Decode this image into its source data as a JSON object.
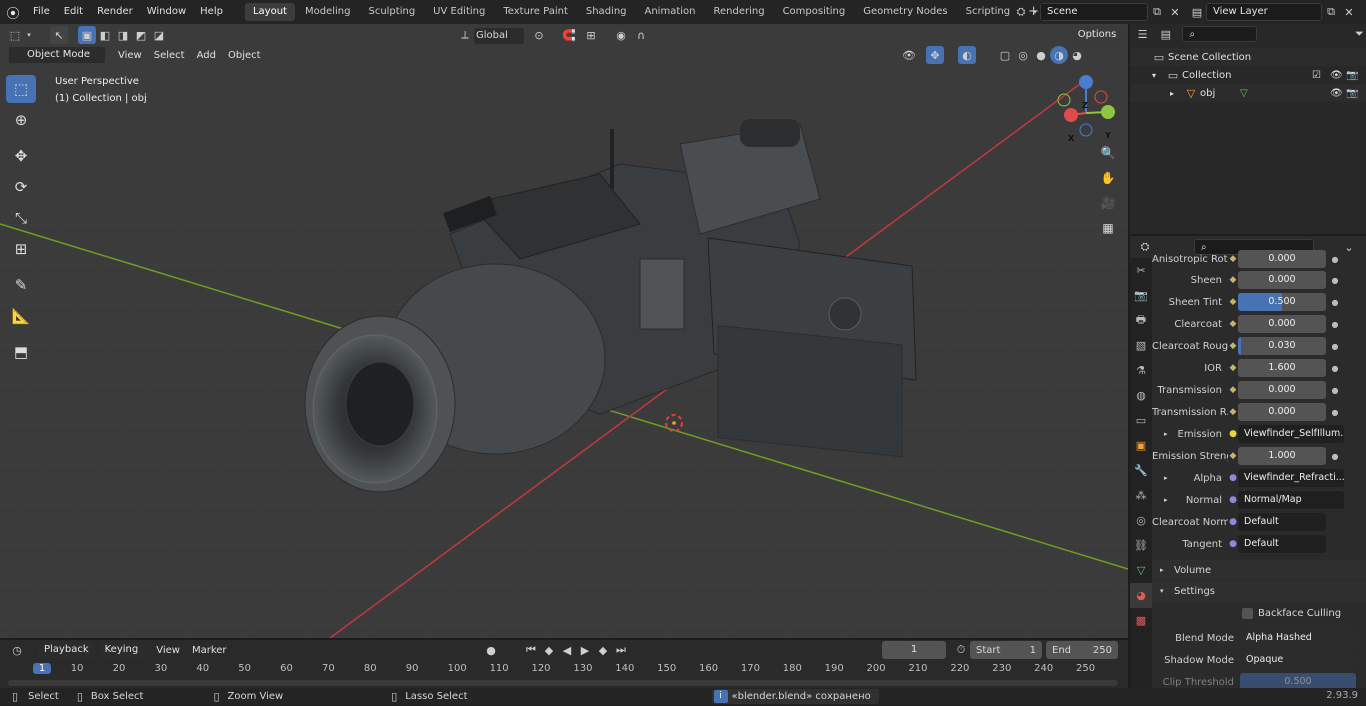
{
  "topbar": {
    "menus": [
      "File",
      "Edit",
      "Render",
      "Window",
      "Help"
    ],
    "workspaces": [
      "Layout",
      "Modeling",
      "Sculpting",
      "UV Editing",
      "Texture Paint",
      "Shading",
      "Animation",
      "Rendering",
      "Compositing",
      "Geometry Nodes",
      "Scripting"
    ],
    "active_workspace": "Layout",
    "add_tab": "+",
    "scene": "Scene",
    "view_layer": "View Layer"
  },
  "viewport": {
    "mode": "Object Mode",
    "menus": [
      "View",
      "Select",
      "Add",
      "Object"
    ],
    "transform_orientation": "Global",
    "options_label": "Options",
    "overlay_title": "User Perspective",
    "overlay_subtitle": "(1) Collection | obj",
    "gizmo": {
      "x": "X",
      "y": "Y",
      "z": "Z"
    }
  },
  "outliner": {
    "search_placeholder": "",
    "items": [
      {
        "label": "Scene Collection"
      },
      {
        "label": "Collection"
      },
      {
        "label": "obj"
      }
    ]
  },
  "properties": {
    "search_placeholder": "",
    "rows": [
      {
        "label": "Anisotropic Rot...",
        "value": "0.000"
      },
      {
        "label": "Sheen",
        "value": "0.000"
      },
      {
        "label": "Sheen Tint",
        "value": "0.500",
        "fill": 0.5
      },
      {
        "label": "Clearcoat",
        "value": "0.000"
      },
      {
        "label": "Clearcoat Roug...",
        "value": "0.030",
        "fill": 0.03
      },
      {
        "label": "IOR",
        "value": "1.600"
      },
      {
        "label": "Transmission",
        "value": "0.000"
      },
      {
        "label": "Transmission R...",
        "value": "0.000"
      },
      {
        "label": "Emission",
        "value": "Viewfinder_SelfIllum..."
      },
      {
        "label": "Emission Strengt",
        "value": "1.000"
      },
      {
        "label": "Alpha",
        "value": "Viewfinder_Refracti..."
      },
      {
        "label": "Normal",
        "value": "Normal/Map"
      },
      {
        "label": "Clearcoat Normal",
        "value": "Default"
      },
      {
        "label": "Tangent",
        "value": "Default"
      }
    ],
    "volume_label": "Volume",
    "settings_label": "Settings",
    "backface_label": "Backface Culling",
    "blend_mode_label": "Blend Mode",
    "blend_mode_value": "Alpha Hashed",
    "shadow_mode_label": "Shadow Mode",
    "shadow_mode_value": "Opaque",
    "clip_label": "Clip Threshold",
    "clip_value": "0.500"
  },
  "timeline": {
    "menus": [
      "Playback",
      "Keying",
      "View",
      "Marker"
    ],
    "current_frame": "1",
    "start_label": "Start",
    "start_value": "1",
    "end_label": "End",
    "end_value": "250",
    "ticks": [
      "1",
      "10",
      "20",
      "30",
      "40",
      "50",
      "60",
      "70",
      "80",
      "90",
      "100",
      "110",
      "120",
      "130",
      "140",
      "150",
      "160",
      "170",
      "180",
      "190",
      "200",
      "210",
      "220",
      "230",
      "240",
      "250"
    ]
  },
  "statusbar": {
    "select": "Select",
    "box_select": "Box Select",
    "zoom_view": "Zoom View",
    "lasso_select": "Lasso Select",
    "message": "«blender.blend» сохранено",
    "version": "2.93.9"
  },
  "colors": {
    "accent": "#4772b3",
    "active_frame": "#4772b3",
    "x_axis": "#c2383f",
    "y_axis": "#6f9e22"
  }
}
